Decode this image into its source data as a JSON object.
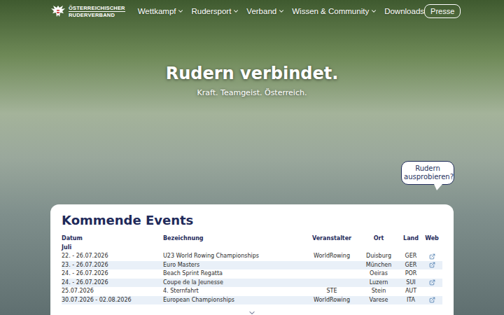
{
  "header": {
    "logo": {
      "line1": "ÖSTERREICHISCHER",
      "line2": "RUDERVERBAND"
    },
    "nav": [
      {
        "label": "Wettkampf",
        "dropdown": true
      },
      {
        "label": "Rudersport",
        "dropdown": true
      },
      {
        "label": "Verband",
        "dropdown": true
      },
      {
        "label": "Wissen & Community",
        "dropdown": true
      },
      {
        "label": "Downloads",
        "dropdown": false
      }
    ],
    "button": "Presse"
  },
  "hero": {
    "title": "Rudern verbindet.",
    "subtitle": "Kraft. Teamgeist. Österreich."
  },
  "bubble": "Rudern ausprobieren?",
  "events": {
    "title": "Kommende Events",
    "columns": [
      "Datum",
      "Bezeichnung",
      "Veranstalter",
      "Ort",
      "Land",
      "Web"
    ],
    "month": "Juli",
    "rows": [
      {
        "date": "22. - 26.07.2026",
        "name": "U23 World Rowing Championships",
        "organizer": "WorldRowing",
        "place": "Duisburg",
        "country": "GER",
        "web": true
      },
      {
        "date": "23. - 26.07.2026",
        "name": "Euro Masters",
        "organizer": "",
        "place": "München",
        "country": "GER",
        "web": true
      },
      {
        "date": "24. - 26.07.2026",
        "name": "Beach Sprint Regatta",
        "organizer": "",
        "place": "Oeiras",
        "country": "POR",
        "web": false
      },
      {
        "date": "24. - 26.07.2026",
        "name": "Coupe de la Jeunesse",
        "organizer": "",
        "place": "Luzern",
        "country": "SUI",
        "web": true
      },
      {
        "date": "25.07.2026",
        "name": "4. Sternfahrt",
        "organizer": "STE",
        "place": "Stein",
        "country": "AUT",
        "web": false
      },
      {
        "date": "30.07.2026 - 02.08.2026",
        "name": "European Championships",
        "organizer": "WorldRowing",
        "place": "Varese",
        "country": "ITA",
        "web": true
      }
    ]
  }
}
